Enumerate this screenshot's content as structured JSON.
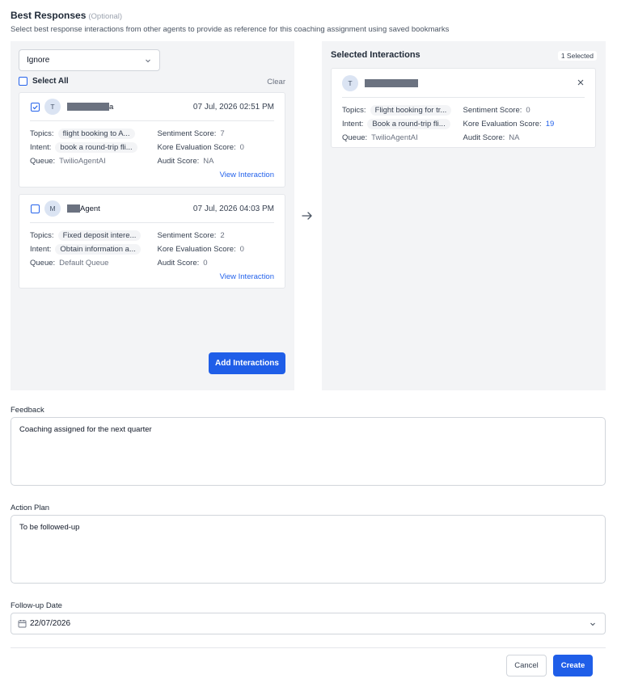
{
  "header": {
    "title": "Best Responses",
    "optional": "(Optional)",
    "subtitle": "Select best response interactions from other agents to provide as reference for this coaching assignment using saved bookmarks"
  },
  "bookmarks": {
    "dropdown_value": "Ignore",
    "select_all_label": "Select All",
    "select_all_checked": false,
    "clear_label": "Clear",
    "cards": [
      {
        "checked": true,
        "avatar": "T",
        "name_suffix": "a",
        "date": "07 Jul, 2026 02:51 PM",
        "topics_label": "Topics:",
        "topics": "flight booking to A...",
        "sentiment_label": "Sentiment Score:",
        "sentiment": "7",
        "intent_label": "Intent:",
        "intent": "book a round-trip fli...",
        "kore_label": "Kore Evaluation Score:",
        "kore": "0",
        "queue_label": "Queue:",
        "queue": "TwilioAgentAI",
        "audit_label": "Audit Score:",
        "audit": "NA",
        "link": "View Interaction"
      },
      {
        "checked": false,
        "avatar": "M",
        "name_suffix": "Agent",
        "date": "07 Jul, 2026 04:03 PM",
        "topics_label": "Topics:",
        "topics": "Fixed deposit intere...",
        "sentiment_label": "Sentiment Score:",
        "sentiment": "2",
        "intent_label": "Intent:",
        "intent": "Obtain information a...",
        "kore_label": "Kore Evaluation Score:",
        "kore": "0",
        "queue_label": "Queue:",
        "queue": "Default Queue",
        "audit_label": "Audit Score:",
        "audit": "0",
        "link": "View Interaction"
      }
    ],
    "add_button": "Add Interactions"
  },
  "selected": {
    "title": "Selected Interactions",
    "badge": "1 Selected",
    "card": {
      "avatar": "T",
      "topics_label": "Topics:",
      "topics": "Flight booking for tr...",
      "sentiment_label": "Sentiment Score:",
      "sentiment": "0",
      "intent_label": "Intent:",
      "intent": "Book a round-trip fli...",
      "kore_label": "Kore Evaluation Score:",
      "kore": "19",
      "queue_label": "Queue:",
      "queue": "TwilioAgentAI",
      "audit_label": "Audit Score:",
      "audit": "NA"
    }
  },
  "form": {
    "feedback_label": "Feedback",
    "feedback_value": "Coaching assigned for the next quarter",
    "action_plan_label": "Action Plan",
    "action_plan_value": "To be followed-up",
    "followup_label": "Follow-up Date",
    "followup_value": "22/07/2026"
  },
  "footer": {
    "cancel": "Cancel",
    "create": "Create"
  },
  "colors": {
    "primary": "#1f5ee8",
    "link": "#2563eb",
    "panel_bg": "#f3f4f6"
  },
  "icons": [
    "chevron-down-icon",
    "arrow-right-icon",
    "close-icon",
    "calendar-icon",
    "check-icon"
  ]
}
